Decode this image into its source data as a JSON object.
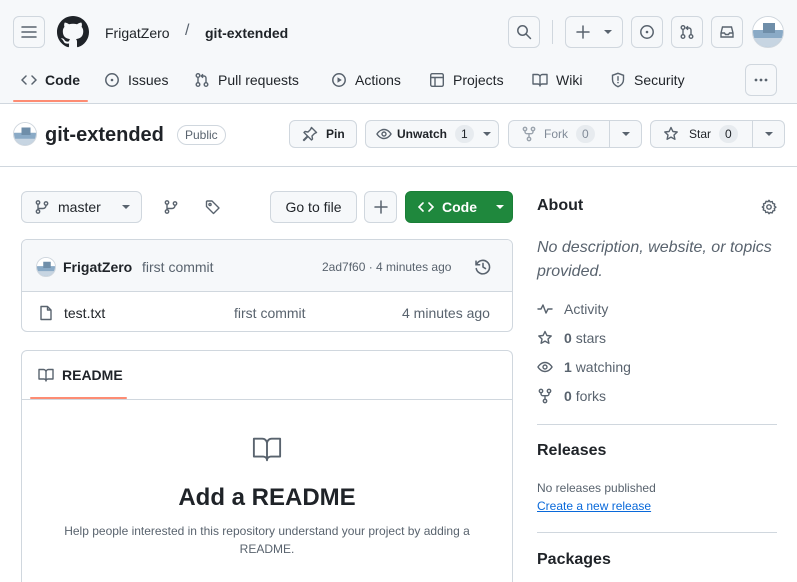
{
  "header": {
    "owner": "FrigatZero",
    "separator": "/",
    "repo": "git-extended"
  },
  "nav": {
    "tabs": [
      {
        "label": "Code"
      },
      {
        "label": "Issues"
      },
      {
        "label": "Pull requests"
      },
      {
        "label": "Actions"
      },
      {
        "label": "Projects"
      },
      {
        "label": "Wiki"
      },
      {
        "label": "Security"
      }
    ]
  },
  "repo": {
    "name": "git-extended",
    "visibility": "Public",
    "pin_label": "Pin",
    "unwatch_label": "Unwatch",
    "watch_count": "1",
    "fork_label": "Fork",
    "fork_count": "0",
    "star_label": "Star",
    "star_count": "0"
  },
  "toolbar": {
    "branch": "master",
    "go_to_file": "Go to file",
    "code_label": "Code"
  },
  "commit": {
    "author": "FrigatZero",
    "message": "first commit",
    "hash_time": "2ad7f60 · 4 minutes ago"
  },
  "files": [
    {
      "name": "test.txt",
      "message": "first commit",
      "time": "4 minutes ago"
    }
  ],
  "readme": {
    "tab_label": "README",
    "title": "Add a README",
    "description": "Help people interested in this repository understand your project by adding a README."
  },
  "about": {
    "title": "About",
    "description": "No description, website, or topics provided.",
    "activity": "Activity",
    "stars_count": "0",
    "stars_label": "stars",
    "watching_count": "1",
    "watching_label": "watching",
    "forks_count": "0",
    "forks_label": "forks"
  },
  "releases": {
    "title": "Releases",
    "none_text": "No releases published",
    "create_link": "Create a new release"
  },
  "packages": {
    "title": "Packages"
  },
  "colors": {
    "accent": "#0969da",
    "code_button": "#1f883d",
    "tab_underline": "#fd8c73"
  }
}
